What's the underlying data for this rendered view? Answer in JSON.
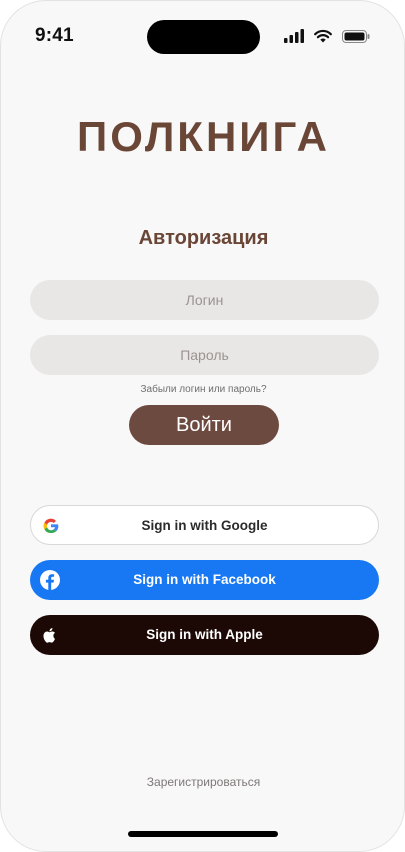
{
  "status_bar": {
    "time": "9:41"
  },
  "brand": {
    "title": "ПОЛКНИГА"
  },
  "auth": {
    "title": "Авторизация",
    "login_placeholder": "Логин",
    "password_placeholder": "Пароль",
    "forgot_text": "Забыли логин или пароль?",
    "submit_label": "Войти"
  },
  "social": {
    "google_label": "Sign in with Google",
    "facebook_label": "Sign in with Facebook",
    "apple_label": "Sign in with Apple"
  },
  "footer": {
    "register_label": "Зарегистрироваться"
  },
  "colors": {
    "brand": "#6a4637",
    "button": "#6d4a40",
    "facebook": "#1877f2",
    "apple": "#1c0906"
  }
}
